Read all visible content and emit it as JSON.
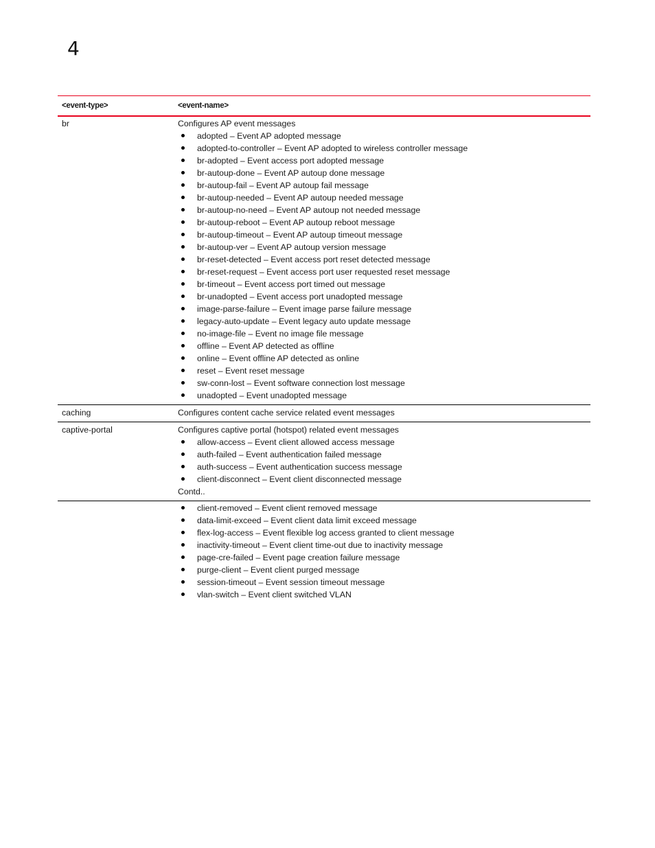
{
  "page": {
    "chapter_number": "4"
  },
  "table": {
    "headers": {
      "event_type": "<event-type>",
      "event_name": "<event-name>"
    },
    "rows": [
      {
        "event_type": "br",
        "description": "Configures AP event messages",
        "items": [
          "adopted – Event AP adopted message",
          "adopted-to-controller – Event AP adopted to wireless controller message",
          "br-adopted – Event access port adopted message",
          "br-autoup-done – Event AP autoup done message",
          "br-autoup-fail – Event AP autoup fail message",
          "br-autoup-needed – Event AP autoup needed message",
          "br-autoup-no-need – Event AP autoup not needed message",
          "br-autoup-reboot – Event AP autoup reboot message",
          "br-autoup-timeout – Event AP autoup timeout message",
          "br-autoup-ver – Event AP autoup version message",
          "br-reset-detected – Event access port reset detected message",
          "br-reset-request – Event access port user requested reset message",
          "br-timeout – Event access port timed out message",
          "br-unadopted – Event access port unadopted message",
          "image-parse-failure – Event image parse failure message",
          "legacy-auto-update – Event legacy auto update message",
          "no-image-file – Event no image file message",
          "offline – Event AP detected as offline",
          "online – Event offline AP detected as online",
          "reset – Event reset message",
          "sw-conn-lost – Event software connection lost message",
          "unadopted – Event unadopted message"
        ]
      },
      {
        "event_type": "caching",
        "description": "Configures content cache service related event messages",
        "items": []
      },
      {
        "event_type": "captive-portal",
        "description": "Configures captive portal (hotspot) related event messages",
        "items": [
          "allow-access – Event client allowed access message",
          "auth-failed – Event authentication failed message",
          "auth-success – Event authentication success message",
          "client-disconnect – Event client disconnected message"
        ],
        "continued_label": "Contd.."
      },
      {
        "event_type": "",
        "description": "",
        "items": [
          "client-removed – Event client removed message",
          "data-limit-exceed – Event client data limit exceed message",
          "flex-log-access – Event flexible log access granted to client message",
          "inactivity-timeout – Event client time-out due to inactivity message",
          "page-cre-failed – Event page creation failure message",
          "purge-client – Event client purged message",
          "session-timeout – Event session timeout message",
          "vlan-switch – Event client switched VLAN"
        ]
      }
    ]
  },
  "colors": {
    "header_rule": "#e8001c",
    "row_rule": "#000000"
  }
}
